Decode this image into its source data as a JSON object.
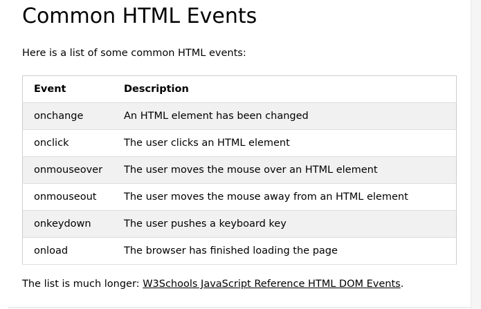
{
  "title": "Common HTML Events",
  "intro": "Here is a list of some common HTML events:",
  "table": {
    "headers": [
      "Event",
      "Description"
    ],
    "rows": [
      [
        "onchange",
        "An HTML element has been changed"
      ],
      [
        "onclick",
        "The user clicks an HTML element"
      ],
      [
        "onmouseover",
        "The user moves the mouse over an HTML element"
      ],
      [
        "onmouseout",
        "The user moves the mouse away from an HTML element"
      ],
      [
        "onkeydown",
        "The user pushes a keyboard key"
      ],
      [
        "onload",
        "The browser has finished loading the page"
      ]
    ]
  },
  "footer": {
    "prefix": "The list is much longer: ",
    "link": "W3Schools JavaScript Reference HTML DOM Events",
    "suffix": "."
  }
}
